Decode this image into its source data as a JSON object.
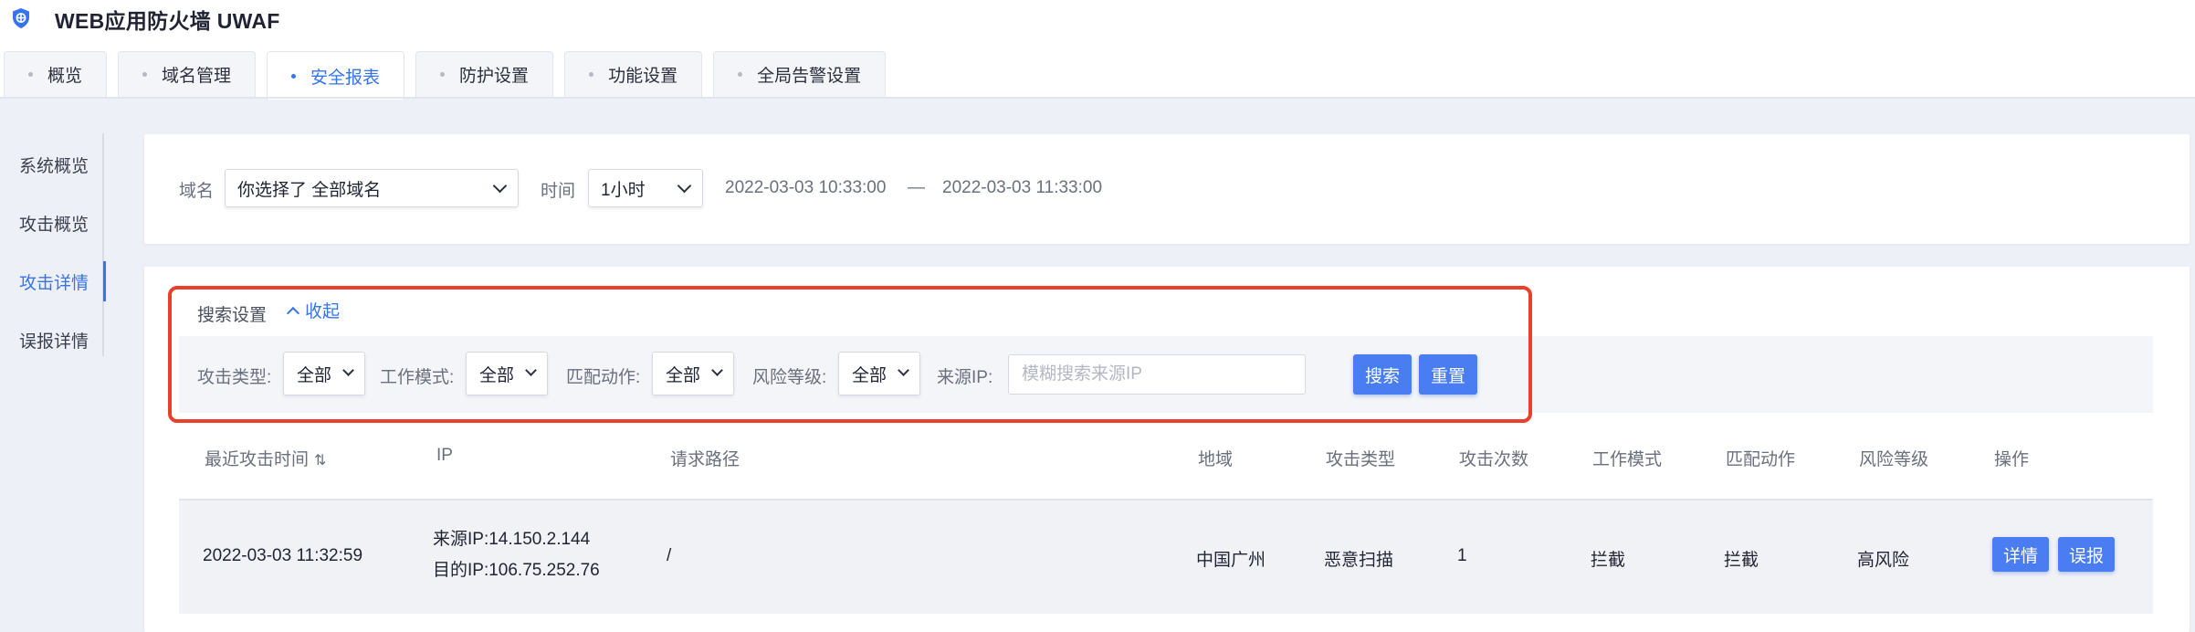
{
  "app": {
    "title": "WEB应用防火墙 UWAF",
    "logo_icon": "shield-icon"
  },
  "tabs": [
    {
      "label": "概览",
      "active": false
    },
    {
      "label": "域名管理",
      "active": false
    },
    {
      "label": "安全报表",
      "active": true
    },
    {
      "label": "防护设置",
      "active": false
    },
    {
      "label": "功能设置",
      "active": false
    },
    {
      "label": "全局告警设置",
      "active": false
    }
  ],
  "sidebar": {
    "items": [
      {
        "label": "系统概览",
        "active": false
      },
      {
        "label": "攻击概览",
        "active": false
      },
      {
        "label": "攻击详情",
        "active": true
      },
      {
        "label": "误报详情",
        "active": false
      }
    ]
  },
  "domain_filter": {
    "domain_label": "域名",
    "domain_value": "你选择了 全部域名",
    "time_label": "时间",
    "time_value": "1小时",
    "start_time": "2022-03-03 10:33:00",
    "separator": "—",
    "end_time": "2022-03-03 11:33:00"
  },
  "search": {
    "title": "搜索设置",
    "collapse_label": "收起",
    "attack_type_label": "攻击类型:",
    "attack_type_value": "全部",
    "work_mode_label": "工作模式:",
    "work_mode_value": "全部",
    "match_action_label": "匹配动作:",
    "match_action_value": "全部",
    "risk_level_label": "风险等级:",
    "risk_level_value": "全部",
    "source_ip_label": "来源IP:",
    "source_ip_value": "",
    "source_ip_placeholder": "模糊搜索来源IP",
    "search_button": "搜索",
    "reset_button": "重置"
  },
  "table": {
    "columns": [
      "最近攻击时间",
      "IP",
      "请求路径",
      "地域",
      "攻击类型",
      "攻击次数",
      "工作模式",
      "匹配动作",
      "风险等级",
      "操作"
    ],
    "sort_icon": "⇅",
    "rows": [
      {
        "time": "2022-03-03 11:32:59",
        "source_ip": "来源IP:14.150.2.144",
        "dest_ip": "目的IP:106.75.252.76",
        "path": "/",
        "region": "中国广州",
        "attack_type": "恶意扫描",
        "count": "1",
        "work_mode": "拦截",
        "match_action": "拦截",
        "risk": "高风险",
        "detail_button": "详情",
        "false_report_button": "误报"
      }
    ]
  },
  "colors": {
    "accent": "#3574f0",
    "button": "#4a7cf2",
    "highlight": "#e8402b",
    "background": "#eef0f7"
  }
}
